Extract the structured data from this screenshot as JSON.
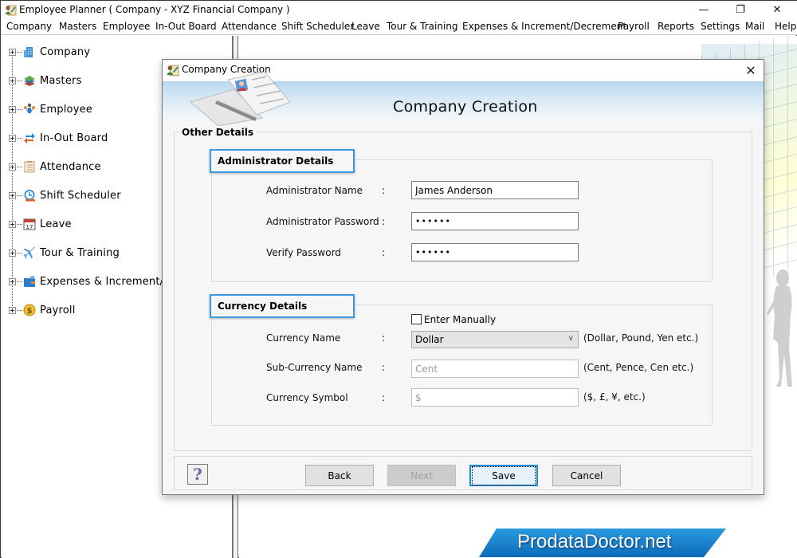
{
  "window": {
    "title": "Employee Planner ( Company - XYZ Financial Company )",
    "controls": {
      "minimize": "—",
      "maximize": "❐",
      "close": "✕"
    }
  },
  "menubar": {
    "items": [
      "Company",
      "Masters",
      "Employee",
      "In-Out Board",
      "Attendance",
      "Shift Scheduler",
      "Leave",
      "Tour & Training",
      "Expenses & Increment/Decrement",
      "Payroll",
      "Reports",
      "Settings",
      "Mail",
      "Help"
    ]
  },
  "tree": {
    "items": [
      {
        "label": "Company",
        "icon": "building-icon"
      },
      {
        "label": "Masters",
        "icon": "layers-icon"
      },
      {
        "label": "Employee",
        "icon": "people-icon"
      },
      {
        "label": "In-Out Board",
        "icon": "swap-arrows-icon"
      },
      {
        "label": "Attendance",
        "icon": "clipboard-icon"
      },
      {
        "label": "Shift Scheduler",
        "icon": "clock-icon"
      },
      {
        "label": "Leave",
        "icon": "calendar-icon",
        "calendar_day": "17"
      },
      {
        "label": "Tour & Training",
        "icon": "airplane-icon"
      },
      {
        "label": "Expenses & Increment/Decrement",
        "icon": "wallet-icon"
      },
      {
        "label": "Payroll",
        "icon": "dollar-coin-icon"
      }
    ]
  },
  "dialog": {
    "title": "Company Creation",
    "heading": "Company Creation",
    "close": "✕",
    "other_details_legend": "Other Details",
    "admin": {
      "legend": "Administrator Details",
      "name_label": "Administrator Name",
      "name_value": "James Anderson",
      "password_label": "Administrator Password",
      "password_value": "••••••",
      "verify_label": "Verify Password",
      "verify_value": "••••••",
      "colon": ":"
    },
    "currency": {
      "legend": "Currency Details",
      "enter_manually_label": "Enter Manually",
      "enter_manually_checked": false,
      "name_label": "Currency Name",
      "name_selected": "Dollar",
      "name_hint": "(Dollar, Pound, Yen etc.)",
      "sub_label": "Sub-Currency Name",
      "sub_value": "Cent",
      "sub_hint": "(Cent, Pence, Cen etc.)",
      "symbol_label": "Currency Symbol",
      "symbol_value": "$",
      "symbol_hint": "($, £, ¥, etc.)",
      "colon": ":"
    },
    "buttons": {
      "help": "?",
      "back": "Back",
      "next": "Next",
      "save": "Save",
      "cancel": "Cancel"
    }
  },
  "branding": {
    "text": "ProdataDoctor.net"
  },
  "colors": {
    "accent": "#3a9ae0",
    "brand": "#0c6bb8",
    "help_icon": "#6a62a8"
  }
}
